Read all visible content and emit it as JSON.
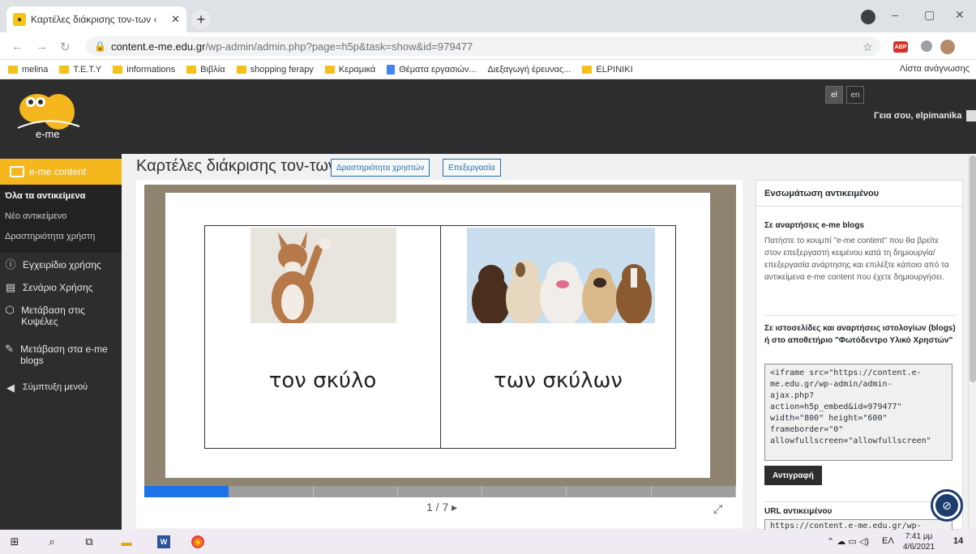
{
  "browser": {
    "tab_title": "Καρτέλες διάκρισης τον-των ‹",
    "tab_close": "✕",
    "new_tab": "+",
    "url_host": "content.e-me.edu.gr",
    "url_path": "/wp-admin/admin.php?page=h5p&task=show&id=979477",
    "window_min": "–",
    "window_restore": "▢",
    "window_close": "✕",
    "extension_abp": "ABP"
  },
  "bookmarks": {
    "items": [
      {
        "label": "melina",
        "icon": "folder-icon"
      },
      {
        "label": "T.E.T.Y",
        "icon": "folder-icon"
      },
      {
        "label": "informations",
        "icon": "folder-icon"
      },
      {
        "label": "Βιβλία",
        "icon": "folder-icon"
      },
      {
        "label": "shopping ferapy",
        "icon": "folder-icon"
      },
      {
        "label": "Κεραμικά",
        "icon": "folder-icon"
      },
      {
        "label": "Θέματα εργασιών...",
        "icon": "doc-icon"
      },
      {
        "label": "Διεξαγωγή έρευνας...",
        "icon": "none"
      },
      {
        "label": "ELPINIKI",
        "icon": "folder-icon"
      }
    ],
    "reading_list": "Λίστα ανάγνωσης"
  },
  "header": {
    "logo_text": "e-me",
    "lang_el": "el",
    "lang_en": "en",
    "greeting": "Γεια σου, elpimanika"
  },
  "sidebar": {
    "active": "e-me content",
    "sub_items": [
      "Όλα τα αντικείμενα",
      "Νέο αντικείμενο",
      "Δραστηριότητα χρήστη"
    ],
    "items": [
      {
        "label": "Εγχειρίδιο χρήσης",
        "icon": "info-icon"
      },
      {
        "label": "Σενάριο Χρήσης",
        "icon": "document-icon"
      },
      {
        "label": "Μετάβαση στις Κυψέλες",
        "icon": "hexagon-icon"
      },
      {
        "label": "Μετάβαση στα e-me blogs",
        "icon": "pencil-icon"
      },
      {
        "label": "Σύμπτυξη μενού",
        "icon": "collapse-icon"
      }
    ]
  },
  "page": {
    "title": "Καρτέλες διάκρισης τον-των",
    "btn_activity": "Δραστηριότητα χρηστών",
    "btn_edit": "Επεξεργασία"
  },
  "h5p": {
    "cards": [
      {
        "word": "τον σκύλο",
        "image": "single dog raising paw"
      },
      {
        "word": "των σκύλων",
        "image": "group of dogs"
      }
    ],
    "pager": "1 / 7 ▸",
    "progress_fraction": 0.143,
    "progress_segments": 7
  },
  "embed": {
    "header": "Ενσωμάτωση αντικειμένου",
    "sec1_title": "Σε αναρτήσεις e-me blogs",
    "sec1_text": "Πατήστε το κουμπί \"e-me content\" που θα βρείτε στον επεξεργαστή κειμένου κατά τη δημιουργία/επεξεργασία ανάρτησης και επιλέξτε κάποιο από τα αντικείμενα e-me content που έχετε δημιουργήσει.",
    "sec2_title": "Σε ιστοσελίδες και αναρτήσεις ιστολογίων (blogs) ή στο αποθετήριο \"Φωτόδεντρο Υλικό Χρηστών\"",
    "code": "<iframe src=\"https://content.e-\nme.edu.gr/wp-admin/admin-\najax.php?\naction=h5p_embed&id=979477\"\nwidth=\"800\" height=\"600\"\nframeborder=\"0\"\nallowfullscreen=\"allowfullscreen\"",
    "copy_button": "Αντιγραφή",
    "url_title": "URL αντικειμένου",
    "url_value": "https://content.e-me.edu.gr/wp-"
  },
  "taskbar": {
    "lang": "ΕΛ",
    "time": "7:41 μμ",
    "date": "4/6/2021",
    "notifications": "14"
  }
}
